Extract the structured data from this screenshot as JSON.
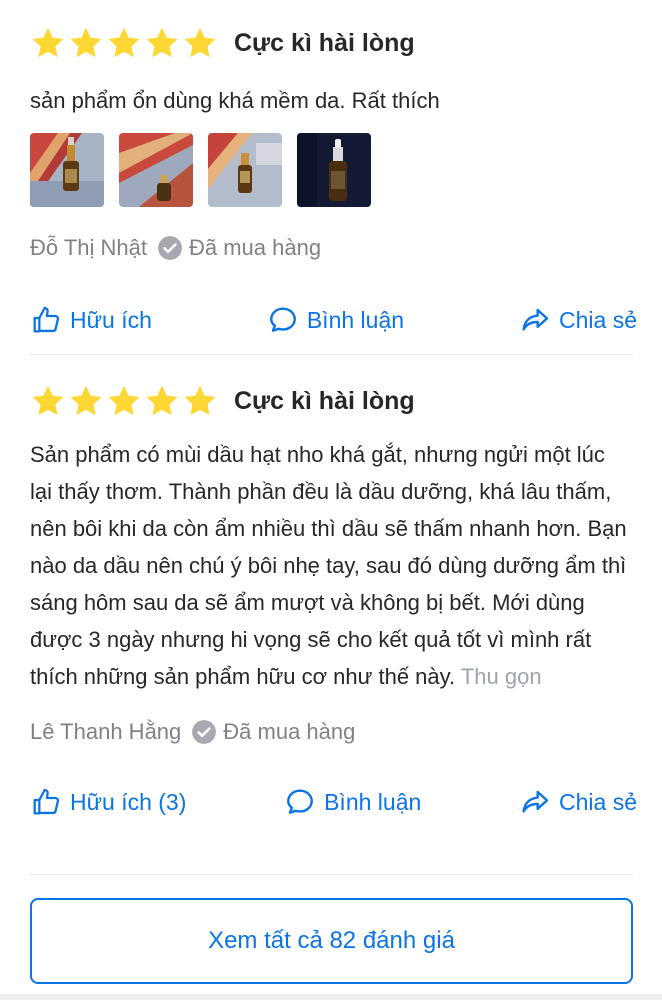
{
  "colors": {
    "star": "#fdd835",
    "accent": "#0b74e5",
    "muted": "#808089",
    "text": "#27272a"
  },
  "reviews": [
    {
      "stars": 5,
      "title": "Cực kì hài lòng",
      "text": "sản phẩm ổn dùng khá mềm da. Rất thích",
      "photos": [
        "product-photo-1",
        "product-photo-2",
        "product-photo-3",
        "product-photo-4"
      ],
      "author": "Đỗ Thị Nhật",
      "purchased": "Đã mua hàng",
      "actions": {
        "helpful": "Hữu ích",
        "comment": "Bình luận",
        "share": "Chia sẻ"
      }
    },
    {
      "stars": 5,
      "title": "Cực kì hài lòng",
      "text": "Sản phẩm có mùi dầu hạt nho khá gắt, nhưng ngửi một lúc lại thấy thơm. Thành phần đều là dầu dưỡng, khá lâu thấm, nên bôi khi da còn ẩm nhiều thì dầu sẽ thấm nhanh hơn. Bạn nào da dầu nên chú ý bôi nhẹ tay, sau đó dùng dưỡng ẩm thì sáng hôm sau da sẽ ẩm mượt và không bị bết. Mới dùng được 3 ngày nhưng hi vọng sẽ cho kết quả tốt vì mình rất thích những sản phẩm hữu cơ như thế này.",
      "collapse": "Thu gọn",
      "author": "Lê Thanh Hằng",
      "purchased": "Đã mua hàng",
      "actions": {
        "helpful": "Hữu ích (3)",
        "comment": "Bình luận",
        "share": "Chia sẻ"
      }
    }
  ],
  "see_all": "Xem tất cả 82 đánh giá",
  "icons": [
    "star-icon",
    "verified-check-icon",
    "thumbs-up-icon",
    "comment-icon",
    "share-icon"
  ]
}
